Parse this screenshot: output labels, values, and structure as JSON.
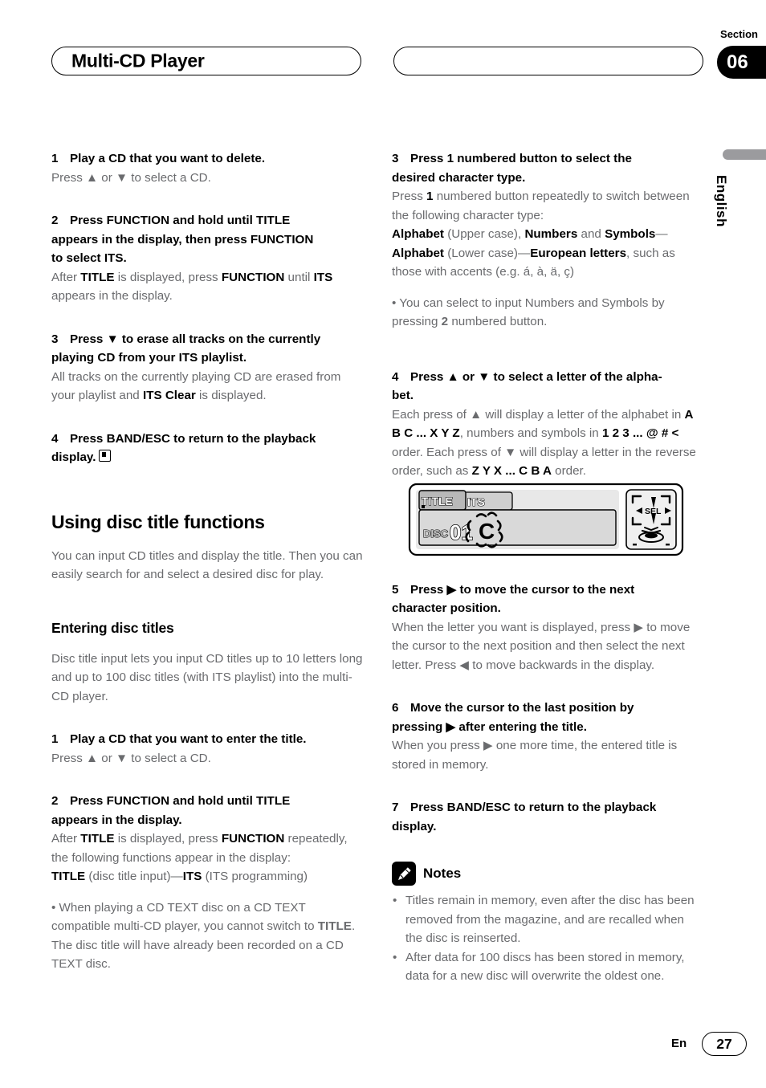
{
  "header": {
    "title": "Multi-CD Player",
    "section_label": "Section",
    "section_number": "06"
  },
  "side_tab": {
    "language": "English"
  },
  "footer": {
    "lang_code": "En",
    "page_number": "27"
  },
  "left_column": {
    "step1": {
      "num": "1",
      "heading": "Play a CD that you want to delete.",
      "body": "Press ▲ or ▼ to select a CD."
    },
    "step2": {
      "num": "2",
      "heading_a": "Press FUNCTION and hold until TITLE",
      "heading_b": "appears in the display, then press FUNCTION",
      "heading_c": "to select ITS.",
      "body_1": "After ",
      "body_2": "TITLE",
      "body_3": " is displayed, press ",
      "body_4": "FUNCTION",
      "body_5": " until ",
      "body_6": "ITS",
      "body_7": " appears in the display."
    },
    "step3": {
      "num": "3",
      "heading_a": "Press ▼ to erase all tracks on the currently",
      "heading_b": "playing CD from your ITS playlist.",
      "body_1": "All tracks on the currently playing CD are erased from your playlist and ",
      "body_2": "ITS Clear",
      "body_3": " is displayed."
    },
    "step4": {
      "num": "4",
      "heading_a": "Press BAND/ESC to return to the playback",
      "heading_b": "display."
    },
    "section_title": "Using disc title functions",
    "section_intro": "You can input CD titles and display the title. Then you can easily search for and select a desired disc for play.",
    "subsection_title": "Entering disc titles",
    "subsection_intro": "Disc title input lets you input CD titles up to 10 letters long and up to 100 disc titles (with ITS playlist) into the multi-CD player.",
    "step5": {
      "num": "1",
      "heading": "Play a CD that you want to enter the title.",
      "body": "Press ▲ or ▼ to select a CD."
    },
    "step6": {
      "num": "2",
      "heading_a": "Press FUNCTION and hold until TITLE",
      "heading_b": "appears in the display.",
      "body_1": "After ",
      "body_2": "TITLE",
      "body_3": " is displayed, press ",
      "body_4": "FUNCTION",
      "body_5": " repeatedly, the following functions appear in the display:",
      "func_1": "TITLE",
      "func_2": " (disc title input)—",
      "func_3": "ITS",
      "func_4": " (ITS programming)",
      "bullet_1": "• When playing a CD TEXT disc on a CD TEXT compatible multi-CD player, you cannot switch to ",
      "bullet_2": "TITLE",
      "bullet_3": ". The disc title will have already been recorded on a CD TEXT disc."
    }
  },
  "right_column": {
    "step3": {
      "num": "3",
      "heading_a": "Press 1 numbered button to select the",
      "heading_b": "desired character type.",
      "body_1": "Press ",
      "body_2": "1",
      "body_3": " numbered button repeatedly to switch between the following character type:",
      "types_1": "Alphabet",
      "types_2": " (Upper case), ",
      "types_3": "Numbers",
      "types_4": " and ",
      "types_5": "Symbols",
      "types_6": "—",
      "types_7": "Alphabet",
      "types_8": " (Lower case)—",
      "types_9": "European letters",
      "types_10": ", such as those with accents (e.g. á, à, ä, ç)",
      "bullet_1": "• You can select to input Numbers and Symbols by pressing ",
      "bullet_2": "2",
      "bullet_3": " numbered button."
    },
    "step4": {
      "num": "4",
      "heading_a": "Press ▲ or ▼ to select a letter of the alpha-",
      "heading_b": "bet.",
      "body_1": "Each press of ▲ will display a letter of the alphabet in ",
      "body_2": "A B C ... X Y Z",
      "body_3": ", numbers and symbols in ",
      "body_4": "1 2 3 ... @ # <",
      "body_5": " order. Each press of ▼ will display a letter in the reverse order, such as ",
      "body_6": "Z Y X ... C B A",
      "body_7": " order."
    },
    "step5": {
      "num": "5",
      "heading_a": "Press ▶ to move the cursor to the next",
      "heading_b": "character position.",
      "body": "When the letter you want is displayed, press ▶ to move the cursor to the next position and then select the next letter. Press ◀ to move backwards in the display."
    },
    "step6": {
      "num": "6",
      "heading_a": "Move the cursor to the last position by",
      "heading_b": "pressing ▶ after entering the title.",
      "body": "When you press ▶ one more time, the entered title is stored in memory."
    },
    "step7": {
      "num": "7",
      "heading_a": "Press BAND/ESC to return to the playback",
      "heading_b": "display."
    },
    "notes": {
      "title": "Notes",
      "icon": "pencil-icon",
      "items": [
        "Titles remain in memory, even after the disc has been removed from the magazine, and are recalled when the disc is reinserted.",
        "After data for 100 discs has been stored in memory, data for a new disc will overwrite the oldest one."
      ]
    },
    "device_display": {
      "tab_active": "TITLE",
      "tab_inactive": "ITS",
      "disc_label": "DISC",
      "disc_number": "01",
      "blinking_char": "C",
      "pad_label": "SEL"
    }
  }
}
